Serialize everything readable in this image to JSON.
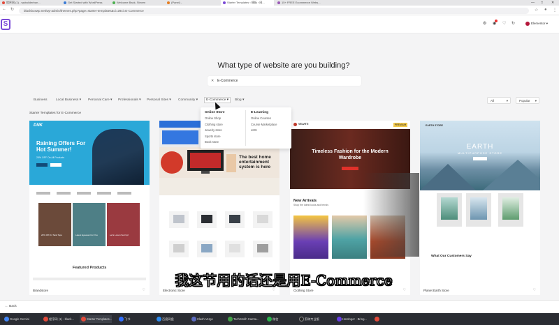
{
  "browser": {
    "tabs": [
      {
        "label": "程序网 (1) - wpbuilderban...",
        "color": "#e24a3b"
      },
      {
        "label": "Get Started with WordPress",
        "color": "#3a7bd5"
      },
      {
        "label": "Welcome Back, Steven",
        "color": "#4caf50"
      },
      {
        "label": "(Panel) -",
        "color": "#e67e22"
      },
      {
        "label": "Starter Templates ‹ 模板 ‹ 网...",
        "color": "#7b4bd6"
      },
      {
        "label": "15+ FREE Ecommerce Webs...",
        "color": "#9b59b6"
      }
    ],
    "url": "blackboxwp.net/wp-admin/themes.php?page=starter-templates&ci=28ci=E-Commerce"
  },
  "header": {
    "logo": "S",
    "account_label": "Elementor"
  },
  "main": {
    "heading": "What type of website are you building?",
    "search_value": "E-Commerce",
    "categories": [
      "Business",
      "Local Business",
      "Personal Care",
      "Professionals",
      "Personal Sites",
      "Community",
      "E-Commerce",
      "Blog"
    ],
    "filters": {
      "type": "All",
      "sort": "Popular"
    },
    "subtitle": "Starter Templates for E-Commerce",
    "dropdown": {
      "col1_title": "Online Store",
      "col1_items": [
        "Online Shop",
        "Clothing store",
        "Jewelry store",
        "Sports store",
        "Book store"
      ],
      "col2_title": "E-Learning",
      "col2_items": [
        "Online Courses",
        "Course Marketplace",
        "LMS"
      ]
    }
  },
  "cards": [
    {
      "name": "Brandstore",
      "brand": "DNK",
      "hero_text": "Raining Offers For Hot Summer!",
      "hero_small": "25% OFF On All Products",
      "featured": "Featured Products",
      "products": [
        "20% Off On Tank Tops",
        "Latest Eyewear For You",
        "Let's Lorem Suit Up!"
      ]
    },
    {
      "name": "Electronic Store",
      "headline": "The best home entertainment system is here"
    },
    {
      "name": "Clothing Store",
      "brand": "VELVETI",
      "hero_text": "Timeless Fashion for the Modern Wardrobe",
      "tag": "PREMIUM",
      "section": "New Arrivals",
      "section_sub": "Shop the latest looks and trends"
    },
    {
      "name": "Planet Earth Store",
      "title": "EARTH",
      "subtitle": "MULTIPURPOSE STORE",
      "nav_label": "EARTH STORE",
      "customers": "What Our Customers Say"
    }
  ],
  "caption": "我这节用的话还是用E-Commerce",
  "footer": {
    "back_label": "Back"
  },
  "taskbar": [
    {
      "label": "Google Gemini",
      "color": "#4285f4"
    },
    {
      "label": "程序网 (1) - black...",
      "color": "#e24a3b"
    },
    {
      "label": "Starter Templates...",
      "color": "#e24a3b"
    },
    {
      "label": "飞书",
      "color": "#3370ff"
    },
    {
      "label": "百度网盘",
      "color": "#2d8cf0"
    },
    {
      "label": "Clash Verge",
      "color": "#5c6bc0"
    },
    {
      "label": "TechSmith Camta...",
      "color": "#43a047"
    },
    {
      "label": "微信",
      "color": "#2bb24c"
    },
    {
      "label": "剪映专业版",
      "color": "#222222"
    },
    {
      "label": "Hostinger - Bring...",
      "color": "#673de6"
    },
    {
      "label": "",
      "color": "#e24a3b"
    }
  ],
  "colors": {
    "brand": "#7b4bd6",
    "accent": "#e24a3b"
  }
}
